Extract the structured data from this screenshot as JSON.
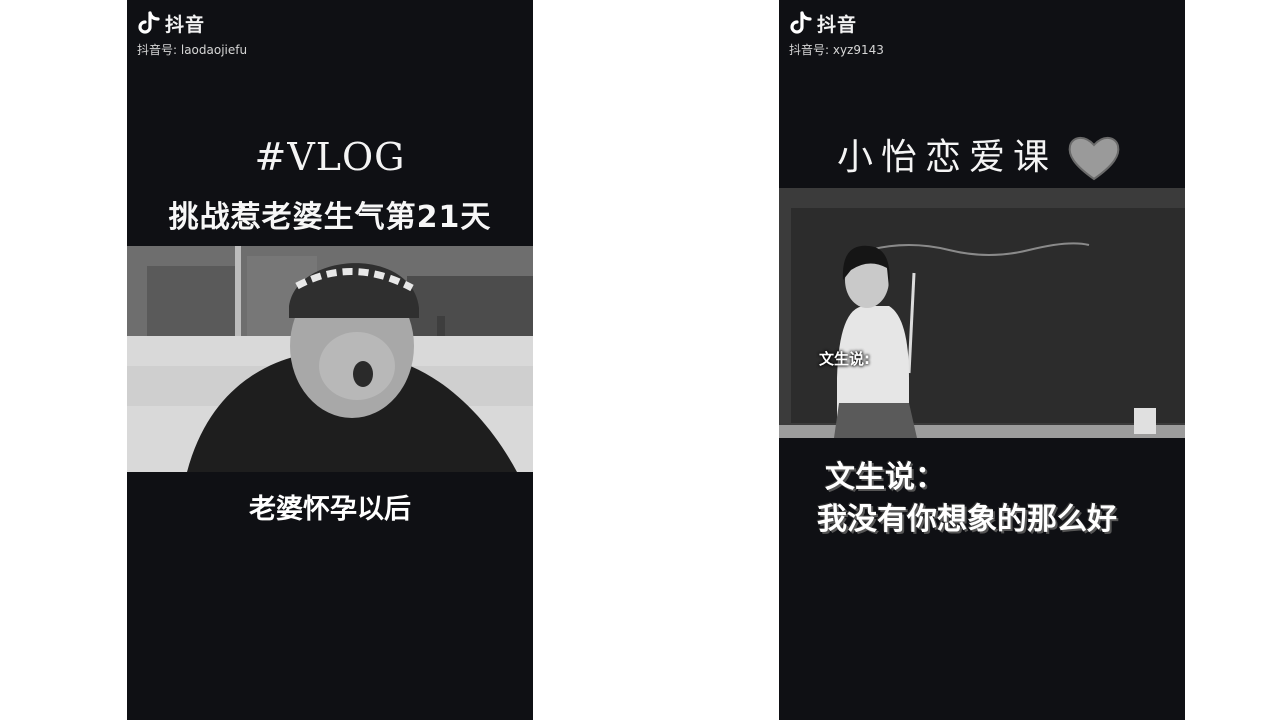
{
  "left_video": {
    "watermark": {
      "brand": "抖音",
      "account_id": "抖音号: laodaojiefu"
    },
    "hashtag": "#VLOG",
    "title": "挑战惹老婆生气第21天",
    "subtitle": "老婆怀孕以后"
  },
  "right_video": {
    "watermark": {
      "brand": "抖音",
      "account_id": "抖音号: xyz9143"
    },
    "course_title": "小怡恋爱课",
    "heart_icon": "heart-icon",
    "speaker_label": "文生说:",
    "caption_line1": "文生说：",
    "caption_line2": "我没有你想象的那么好"
  },
  "colors": {
    "page_background": "#ffffff",
    "panel_background": "#0f1014",
    "text": "#ffffff"
  }
}
